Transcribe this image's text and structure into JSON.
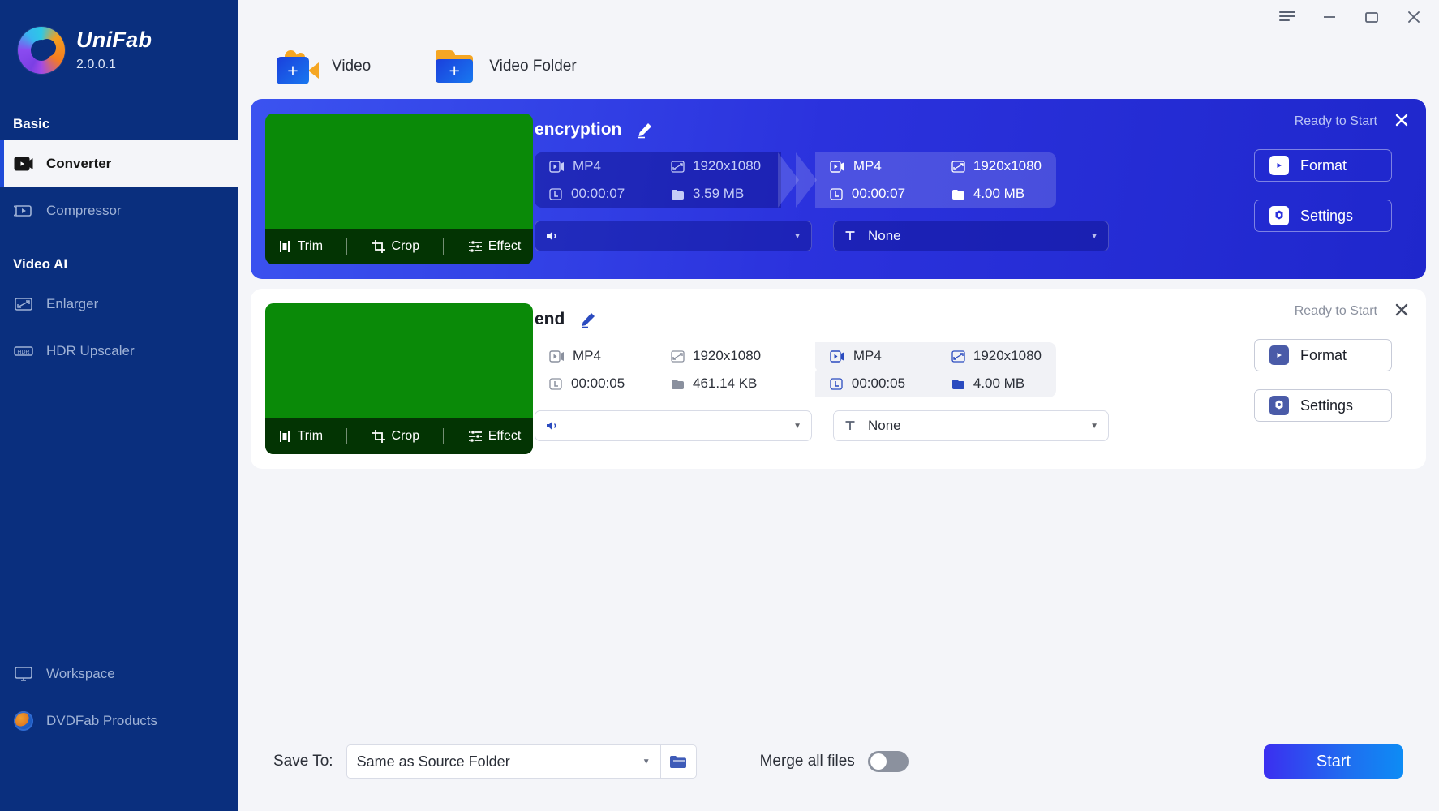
{
  "brand": {
    "name": "UniFab",
    "version": "2.0.0.1"
  },
  "sidebar": {
    "groups": [
      {
        "label": "Basic"
      },
      {
        "label": "Video AI"
      }
    ],
    "items": [
      {
        "label": "Converter",
        "icon": "video-play-icon",
        "active": true
      },
      {
        "label": "Compressor",
        "icon": "compress-icon",
        "active": false
      },
      {
        "label": "Enlarger",
        "icon": "enlarge-icon",
        "active": false
      },
      {
        "label": "HDR Upscaler",
        "icon": "hdr-icon",
        "active": false
      },
      {
        "label": "Workspace",
        "icon": "monitor-icon",
        "active": false
      },
      {
        "label": "DVDFab Products",
        "icon": "dvdfab-icon",
        "active": false
      }
    ]
  },
  "titlebar": {
    "menu": "menu-icon",
    "minimize": "minimize-icon",
    "maximize": "maximize-icon",
    "close": "close-icon"
  },
  "toolbar": {
    "add_video": "Video",
    "add_video_folder": "Video Folder"
  },
  "cards": [
    {
      "name": "encryption",
      "status": "Ready to Start",
      "selected": true,
      "source": {
        "format": "MP4",
        "resolution": "1920x1080",
        "duration": "00:00:07",
        "size": "3.59 MB"
      },
      "target": {
        "format": "MP4",
        "resolution": "1920x1080",
        "duration": "00:00:07",
        "size": "4.00 MB"
      },
      "audio_track": "",
      "subtitle_track": "None",
      "thumb_actions": [
        "Trim",
        "Crop",
        "Effect"
      ],
      "format_button": "Format",
      "settings_button": "Settings"
    },
    {
      "name": "end",
      "status": "Ready to Start",
      "selected": false,
      "source": {
        "format": "MP4",
        "resolution": "1920x1080",
        "duration": "00:00:05",
        "size": "461.14 KB"
      },
      "target": {
        "format": "MP4",
        "resolution": "1920x1080",
        "duration": "00:00:05",
        "size": "4.00 MB"
      },
      "audio_track": "",
      "subtitle_track": "None",
      "thumb_actions": [
        "Trim",
        "Crop",
        "Effect"
      ],
      "format_button": "Format",
      "settings_button": "Settings"
    }
  ],
  "footer": {
    "save_to_label": "Save To:",
    "save_to_value": "Same as Source Folder",
    "browse_icon": "folder-icon",
    "merge_label": "Merge all files",
    "merge_enabled": false,
    "start_label": "Start"
  },
  "colors": {
    "sidebar_bg": "#0a2f7e",
    "accent": "#2b32dd",
    "page_bg": "#f4f5f9",
    "thumb_green": "#0a8a08",
    "start_gradient_from": "#3b2ff0",
    "start_gradient_to": "#0d8cf5"
  }
}
